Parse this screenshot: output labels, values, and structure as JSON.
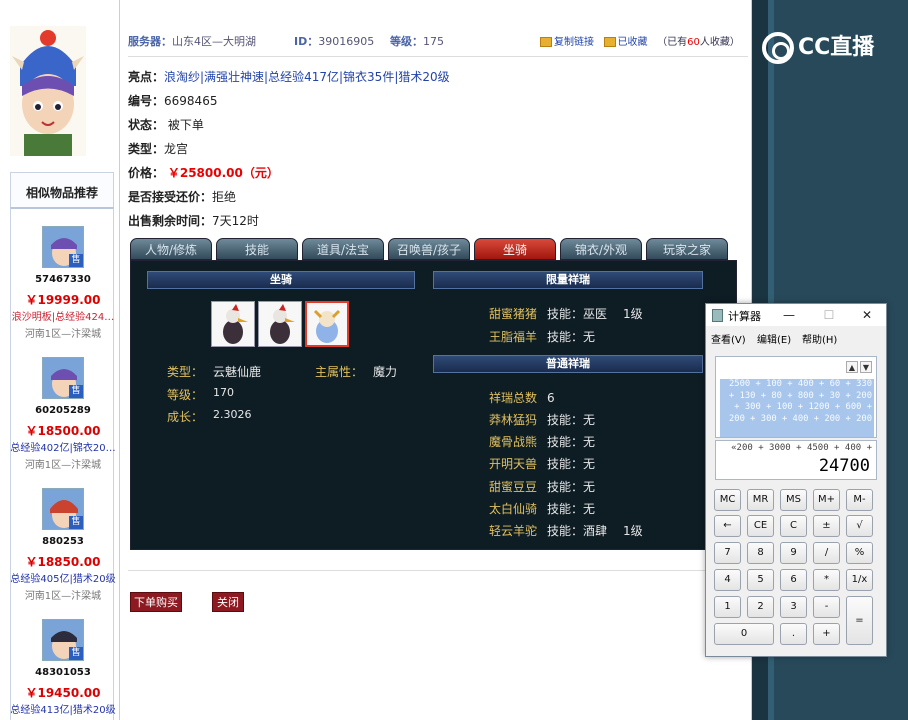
{
  "header": {
    "server_label": "服务器：",
    "server_value": "山东4区—大明湖",
    "id_label": "ID：",
    "id_value": "39016905",
    "level_label": "等级：",
    "level_value": "175",
    "copy_link": "复制链接",
    "favorited": "已收藏",
    "fav_count_prefix": "（已有",
    "fav_count": "60",
    "fav_count_suffix": "人收藏）"
  },
  "details": {
    "highlights_label": "亮点：",
    "highlights": "浪淘纱|满强壮神速|总经验417亿|锦衣35件|猎术20级",
    "serial_label": "编号：",
    "serial": "6698465",
    "status_label": "状态：",
    "status": "被下单",
    "type_label": "类型：",
    "type": "龙宫",
    "price_label": "价格：",
    "price": "￥25800.00（元）",
    "counter_label": "是否接受还价：",
    "counter": "拒绝",
    "time_label": "出售剩余时间：",
    "time": "7天12时"
  },
  "tabs": [
    "人物/修炼",
    "技能",
    "道具/法宝",
    "召唤兽/孩子",
    "坐骑",
    "锦衣/外观",
    "玩家之家"
  ],
  "mount_panel": {
    "header": "坐骑",
    "type_label": "类型：",
    "type": "云魅仙鹿",
    "attr_label": "主属性：",
    "attr": "魔力",
    "level_label": "等级：",
    "level": "170",
    "growth_label": "成长：",
    "growth": "2.3026"
  },
  "limited_header": "限量祥瑞",
  "limited": [
    {
      "name": "甜蜜猪猪",
      "skill_label": "技能：",
      "skill": "巫医",
      "lvl": "1级"
    },
    {
      "name": "王脂福羊",
      "skill_label": "技能：",
      "skill": "无",
      "lvl": ""
    }
  ],
  "normal_header": "普通祥瑞",
  "normal_count_label": "祥瑞总数",
  "normal_count": "6",
  "normal": [
    {
      "name": "莽林猛犸",
      "skill_label": "技能：",
      "skill": "无",
      "lvl": ""
    },
    {
      "name": "魔骨战熊",
      "skill_label": "技能：",
      "skill": "无",
      "lvl": ""
    },
    {
      "name": "开明天兽",
      "skill_label": "技能：",
      "skill": "无",
      "lvl": ""
    },
    {
      "name": "甜蜜豆豆",
      "skill_label": "技能：",
      "skill": "无",
      "lvl": ""
    },
    {
      "name": "太白仙骑",
      "skill_label": "技能：",
      "skill": "无",
      "lvl": ""
    },
    {
      "name": "轻云羊驼",
      "skill_label": "技能：",
      "skill": "酒肆",
      "lvl": "1级"
    }
  ],
  "actions": {
    "buy": "下单购买",
    "close": "关闭"
  },
  "similar": {
    "title": "相似物品推荐",
    "badge": "售",
    "items": [
      {
        "id": "57467330",
        "price": "￥19999.00",
        "tags": "浪沙明板|总经验424…",
        "server": "河南1区—汴梁城"
      },
      {
        "id": "60205289",
        "price": "￥18500.00",
        "tags": "总经验402亿|锦衣20…",
        "server": "河南1区—汴梁城"
      },
      {
        "id": "880253",
        "price": "￥18850.00",
        "tags": "总经验405亿|猎术20级",
        "server": "河南1区—汴梁城"
      },
      {
        "id": "48301053",
        "price": "￥19450.00",
        "tags": "总经验413亿|猎术20级",
        "server": ""
      }
    ]
  },
  "stream": {
    "logo": "CC直播"
  },
  "calculator": {
    "title": "计算器",
    "menu": [
      "查看(V)",
      "编辑(E)",
      "帮助(H)"
    ],
    "history": "2500 + 100 + 400 + 60 + 330 + 130 + 80 + 800 + 30 + 200 + 300 + 100 + 1200 + 600 + 200 + 300 + 400 + 200 + 200",
    "expression": "«200 + 3000 + 4500 + 400 +",
    "result": "24700",
    "keys": [
      "MC",
      "MR",
      "MS",
      "M+",
      "M-",
      "←",
      "CE",
      "C",
      "±",
      "√",
      "7",
      "8",
      "9",
      "/",
      "%",
      "4",
      "5",
      "6",
      "*",
      "1/x",
      "1",
      "2",
      "3",
      "-",
      "=",
      "0",
      ".",
      "+"
    ]
  },
  "colors": {
    "accent": "#a1160e",
    "panel": "#0e1c24",
    "gold": "#e0c060",
    "link": "#2244aa"
  }
}
